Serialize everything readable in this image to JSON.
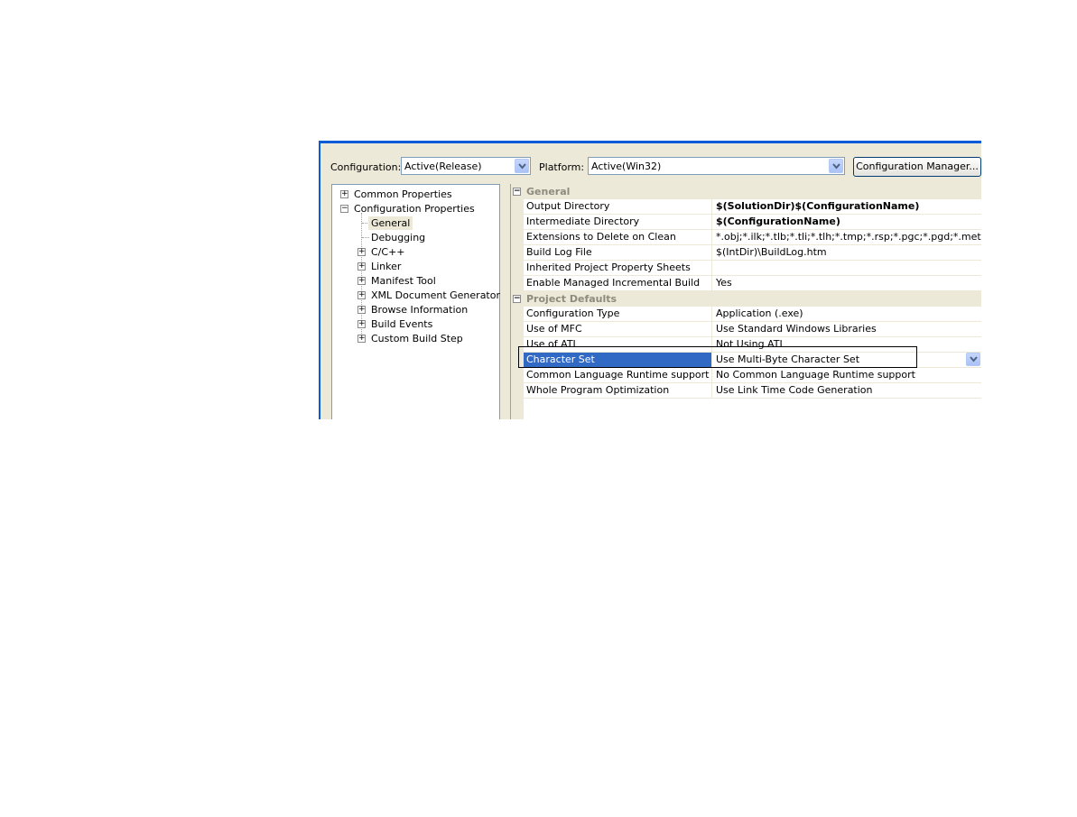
{
  "toolbar": {
    "configuration_label": "Configuration:",
    "configuration_value": "Active(Release)",
    "platform_label": "Platform:",
    "platform_value": "Active(Win32)",
    "config_manager_button": "Configuration Manager..."
  },
  "tree": {
    "common_properties": "Common Properties",
    "configuration_properties": "Configuration Properties",
    "children": [
      "General",
      "Debugging",
      "C/C++",
      "Linker",
      "Manifest Tool",
      "XML Document Generator",
      "Browse Information",
      "Build Events",
      "Custom Build Step"
    ],
    "selected": "General"
  },
  "grid": {
    "categories": {
      "general": "General",
      "project_defaults": "Project Defaults"
    },
    "general_rows": [
      {
        "name": "Output Directory",
        "value": "$(SolutionDir)$(ConfigurationName)"
      },
      {
        "name": "Intermediate Directory",
        "value": "$(ConfigurationName)"
      },
      {
        "name": "Extensions to Delete on Clean",
        "value": "*.obj;*.ilk;*.tlb;*.tli;*.tlh;*.tmp;*.rsp;*.pgc;*.pgd;*.meta;$("
      },
      {
        "name": "Build Log File",
        "value": "$(IntDir)\\BuildLog.htm"
      },
      {
        "name": "Inherited Project Property Sheets",
        "value": ""
      },
      {
        "name": "Enable Managed Incremental Build",
        "value": "Yes"
      }
    ],
    "defaults_rows": [
      {
        "name": "Configuration Type",
        "value": "Application (.exe)"
      },
      {
        "name": "Use of MFC",
        "value": "Use Standard Windows Libraries"
      },
      {
        "name": "Use of ATL",
        "value": "Not Using ATL"
      },
      {
        "name": "Character Set",
        "value": "Use Multi-Byte Character Set"
      },
      {
        "name": "Common Language Runtime support",
        "value": "No Common Language Runtime support"
      },
      {
        "name": "Whole Program Optimization",
        "value": "Use Link Time Code Generation"
      }
    ],
    "selected_row": "Character Set"
  },
  "colors": {
    "selection": "#316ac5",
    "dialog_bg": "#ece9d8",
    "title_border": "#0a5bd8"
  }
}
